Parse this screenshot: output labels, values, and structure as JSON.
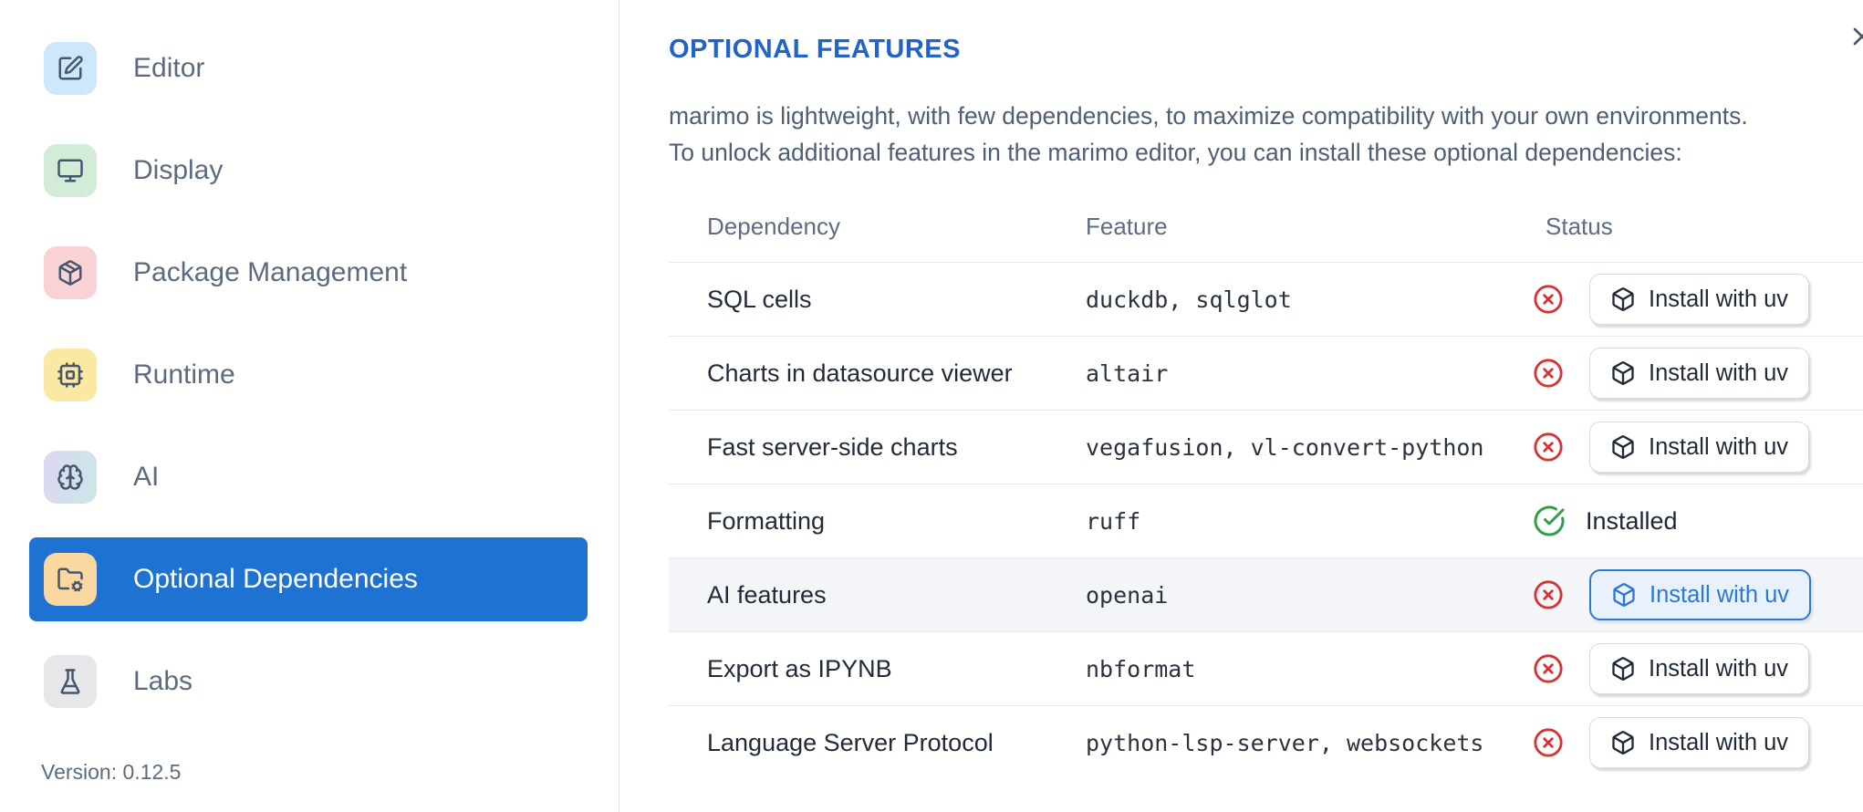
{
  "sidebar": {
    "items": [
      {
        "label": "Editor",
        "icon": "square-pen",
        "icon_bg": "#cde7fb"
      },
      {
        "label": "Display",
        "icon": "monitor",
        "icon_bg": "#d3ecd8"
      },
      {
        "label": "Package Management",
        "icon": "package",
        "icon_bg": "#f9d2d6"
      },
      {
        "label": "Runtime",
        "icon": "cpu",
        "icon_bg": "#fbe8a3"
      },
      {
        "label": "AI",
        "icon": "brain",
        "icon_bg": "linear-gradient(100deg,#ded7f3 0%,#c9e7e6 100%)"
      },
      {
        "label": "Optional Dependencies",
        "icon": "folder-cog",
        "icon_bg": "#fad8a0",
        "selected": true
      },
      {
        "label": "Labs",
        "icon": "flask",
        "icon_bg": "#e7e7ea"
      }
    ],
    "version_label": "Version: 0.12.5"
  },
  "dialog": {
    "close_icon": "x"
  },
  "main": {
    "title": "OPTIONAL FEATURES",
    "description_line1": "marimo is lightweight, with few dependencies, to maximize compatibility with your own environments.",
    "description_line2": "To unlock additional features in the marimo editor, you can install these optional dependencies:",
    "table": {
      "headers": [
        "Dependency",
        "Feature",
        "Status"
      ],
      "rows": [
        {
          "dependency": "SQL cells",
          "feature": "duckdb, sqlglot",
          "status": "missing",
          "action": "Install with uv"
        },
        {
          "dependency": "Charts in datasource viewer",
          "feature": "altair",
          "status": "missing",
          "action": "Install with uv"
        },
        {
          "dependency": "Fast server-side charts",
          "feature": "vegafusion, vl-convert-python",
          "status": "missing",
          "action": "Install with uv"
        },
        {
          "dependency": "Formatting",
          "feature": "ruff",
          "status": "installed",
          "status_label": "Installed"
        },
        {
          "dependency": "AI features",
          "feature": "openai",
          "status": "missing",
          "action": "Install with uv",
          "highlighted": true
        },
        {
          "dependency": "Export as IPYNB",
          "feature": "nbformat",
          "status": "missing",
          "action": "Install with uv"
        },
        {
          "dependency": "Language Server Protocol",
          "feature": "python-lsp-server, websockets",
          "status": "missing",
          "action": "Install with uv"
        }
      ]
    }
  },
  "colors": {
    "accent": "#1e73d2",
    "title": "#2263c8",
    "danger": "#d43434",
    "success": "#2f9e44",
    "hl-border": "#2b79d6",
    "hl-bg": "#e9f1fd"
  }
}
